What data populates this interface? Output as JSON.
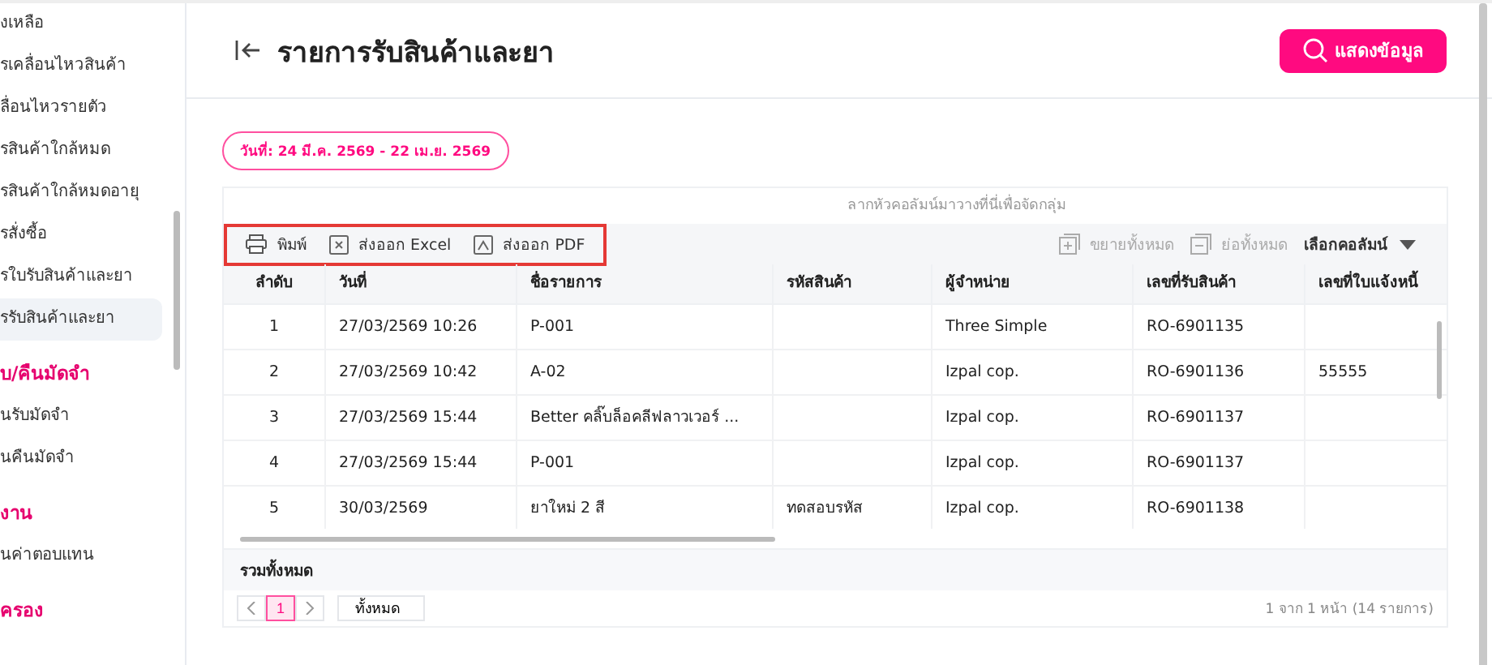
{
  "sidebar": {
    "items": [
      {
        "kind": "item",
        "label": "งเหลือ",
        "selected": false
      },
      {
        "kind": "item",
        "label": "รเคลื่อนไหวสินค้า",
        "selected": false
      },
      {
        "kind": "item",
        "label": "ลื่อนไหวรายตัว",
        "selected": false
      },
      {
        "kind": "item",
        "label": "รสินค้าใกล้หมด",
        "selected": false
      },
      {
        "kind": "item",
        "label": "รสินค้าใกล้หมดอายุ",
        "selected": false
      },
      {
        "kind": "item",
        "label": "รสั่งซื้อ",
        "selected": false
      },
      {
        "kind": "item",
        "label": "รใบรับสินค้าและยา",
        "selected": false
      },
      {
        "kind": "item",
        "label": "รรับสินค้าและยา",
        "selected": true
      },
      {
        "kind": "section",
        "label": "บ/คืนมัดจำ"
      },
      {
        "kind": "item",
        "label": "นรับมัดจำ",
        "selected": false
      },
      {
        "kind": "item",
        "label": "นคืนมัดจำ",
        "selected": false
      },
      {
        "kind": "section",
        "label": "งาน"
      },
      {
        "kind": "item",
        "label": "นค่าตอบแทน",
        "selected": false
      },
      {
        "kind": "section",
        "label": "ครอง"
      }
    ]
  },
  "header": {
    "title": "รายการรับสินค้าและยา",
    "button": "แสดงข้อมูล"
  },
  "date_chip": "วันที่: 24 มี.ค. 2569 - 22 เม.ย. 2569",
  "table": {
    "group_hint": "ลากหัวคอลัมน์มาวางที่นี่เพื่อจัดกลุ่ม",
    "toolbar_left": [
      {
        "kind": "print",
        "label": "พิมพ์"
      },
      {
        "kind": "excel",
        "label": "ส่งออก Excel"
      },
      {
        "kind": "pdf",
        "label": "ส่งออก PDF"
      }
    ],
    "toolbar_right": [
      {
        "kind": "expand",
        "label": "ขยายทั้งหมด",
        "disabled": true
      },
      {
        "kind": "collapse",
        "label": "ย่อทั้งหมด",
        "disabled": true
      }
    ],
    "column_chooser": "เลือกคอลัมน์",
    "columns": [
      "ลำดับ",
      "วันที่",
      "ชื่อรายการ",
      "รหัสสินค้า",
      "ผู้จำหน่าย",
      "เลขที่รับสินค้า",
      "เลขที่ใบแจ้งหนี้"
    ],
    "rows": [
      [
        "1",
        "27/03/2569 10:26",
        "P-001",
        "",
        "Three Simple",
        "RO-6901135",
        ""
      ],
      [
        "2",
        "27/03/2569 10:42",
        "A-02",
        "",
        "Izpal cop.",
        "RO-6901136",
        "55555"
      ],
      [
        "3",
        "27/03/2569 15:44",
        "Better คลิ๊บล็อคลีฟลาวเวอร์ ...",
        "",
        "Izpal cop.",
        "RO-6901137",
        ""
      ],
      [
        "4",
        "27/03/2569 15:44",
        "P-001",
        "",
        "Izpal cop.",
        "RO-6901137",
        ""
      ],
      [
        "5",
        "30/03/2569",
        "ยาใหม่ 2 สี",
        "ทดสอบรหัส",
        "Izpal cop.",
        "RO-6901138",
        ""
      ]
    ],
    "total_label": "รวมทั้งหมด"
  },
  "pager": {
    "pages": [
      {
        "label": "1",
        "selected": true
      }
    ],
    "page_size": "ทั้งหมด",
    "summary": "1 จาก 1 หน้า (14 รายการ)"
  }
}
